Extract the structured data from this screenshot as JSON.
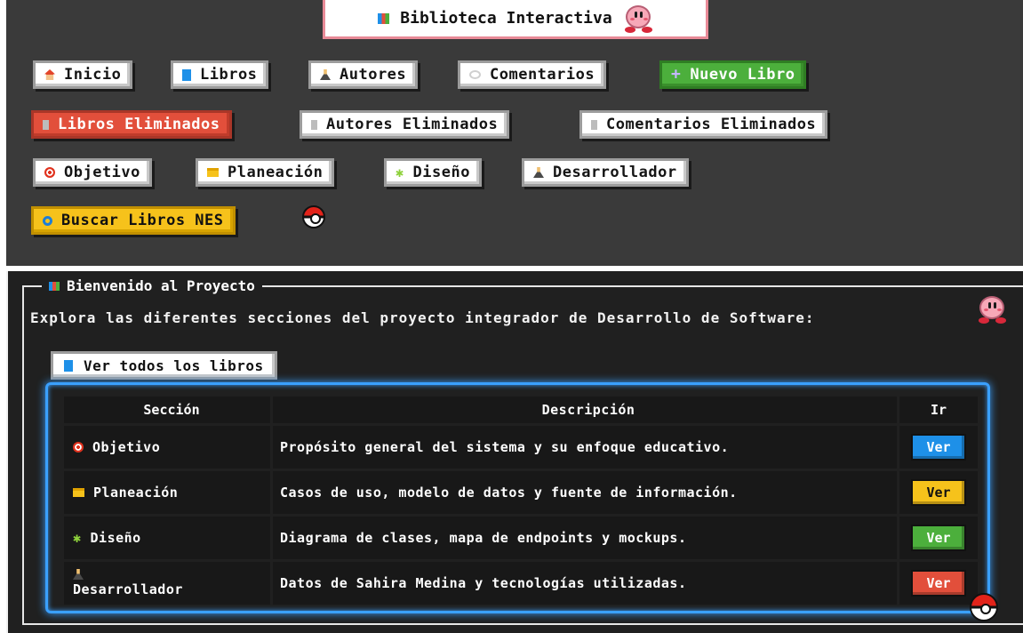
{
  "header": {
    "title": "Biblioteca Interactiva"
  },
  "nav": {
    "row1": [
      {
        "label": "Inicio",
        "icon": "house-icon"
      },
      {
        "label": "Libros",
        "icon": "book-icon"
      },
      {
        "label": "Autores",
        "icon": "person-icon"
      },
      {
        "label": "Comentarios",
        "icon": "speech-bubble-icon"
      },
      {
        "label": "Nuevo Libro",
        "icon": "plus-icon"
      }
    ],
    "row2": [
      {
        "label": "Libros Eliminados",
        "icon": "trash-icon"
      },
      {
        "label": "Autores Eliminados",
        "icon": "trash-icon"
      },
      {
        "label": "Comentarios Eliminados",
        "icon": "trash-icon"
      }
    ],
    "row3": [
      {
        "label": "Objetivo",
        "icon": "target-icon"
      },
      {
        "label": "Planeación",
        "icon": "folder-icon"
      },
      {
        "label": "Diseño",
        "icon": "gear-icon"
      },
      {
        "label": "Desarrollador",
        "icon": "person-icon"
      }
    ],
    "row4": [
      {
        "label": "Buscar Libros NES",
        "icon": "search-icon"
      }
    ]
  },
  "welcome": {
    "legend": "Bienvenido al Proyecto",
    "intro": "Explora las diferentes secciones del proyecto integrador de Desarrollo de Software:",
    "view_all": "Ver todos los libros"
  },
  "table": {
    "headers": [
      "Sección",
      "Descripción",
      "Ir"
    ],
    "rows": [
      {
        "section": "Objetivo",
        "description": "Propósito general del sistema y su enfoque educativo.",
        "action": "Ver",
        "color": "#1e90e8"
      },
      {
        "section": "Planeación",
        "description": "Casos de uso, modelo de datos y fuente de información.",
        "action": "Ver",
        "color": "#f6c21b"
      },
      {
        "section": "Diseño",
        "description": "Diagrama de clases, mapa de endpoints y mockups.",
        "action": "Ver",
        "color": "#4caf3c"
      },
      {
        "section": "Desarrollador",
        "description": "Datos de Sahira Medina y tecnologías utilizadas.",
        "action": "Ver",
        "color": "#e24f3b"
      }
    ]
  },
  "colors": {
    "green": "#4caf3c",
    "red": "#e24f3b",
    "yellow": "#f6c21b",
    "blue": "#1e90e8",
    "glow": "#3aa0ff"
  }
}
